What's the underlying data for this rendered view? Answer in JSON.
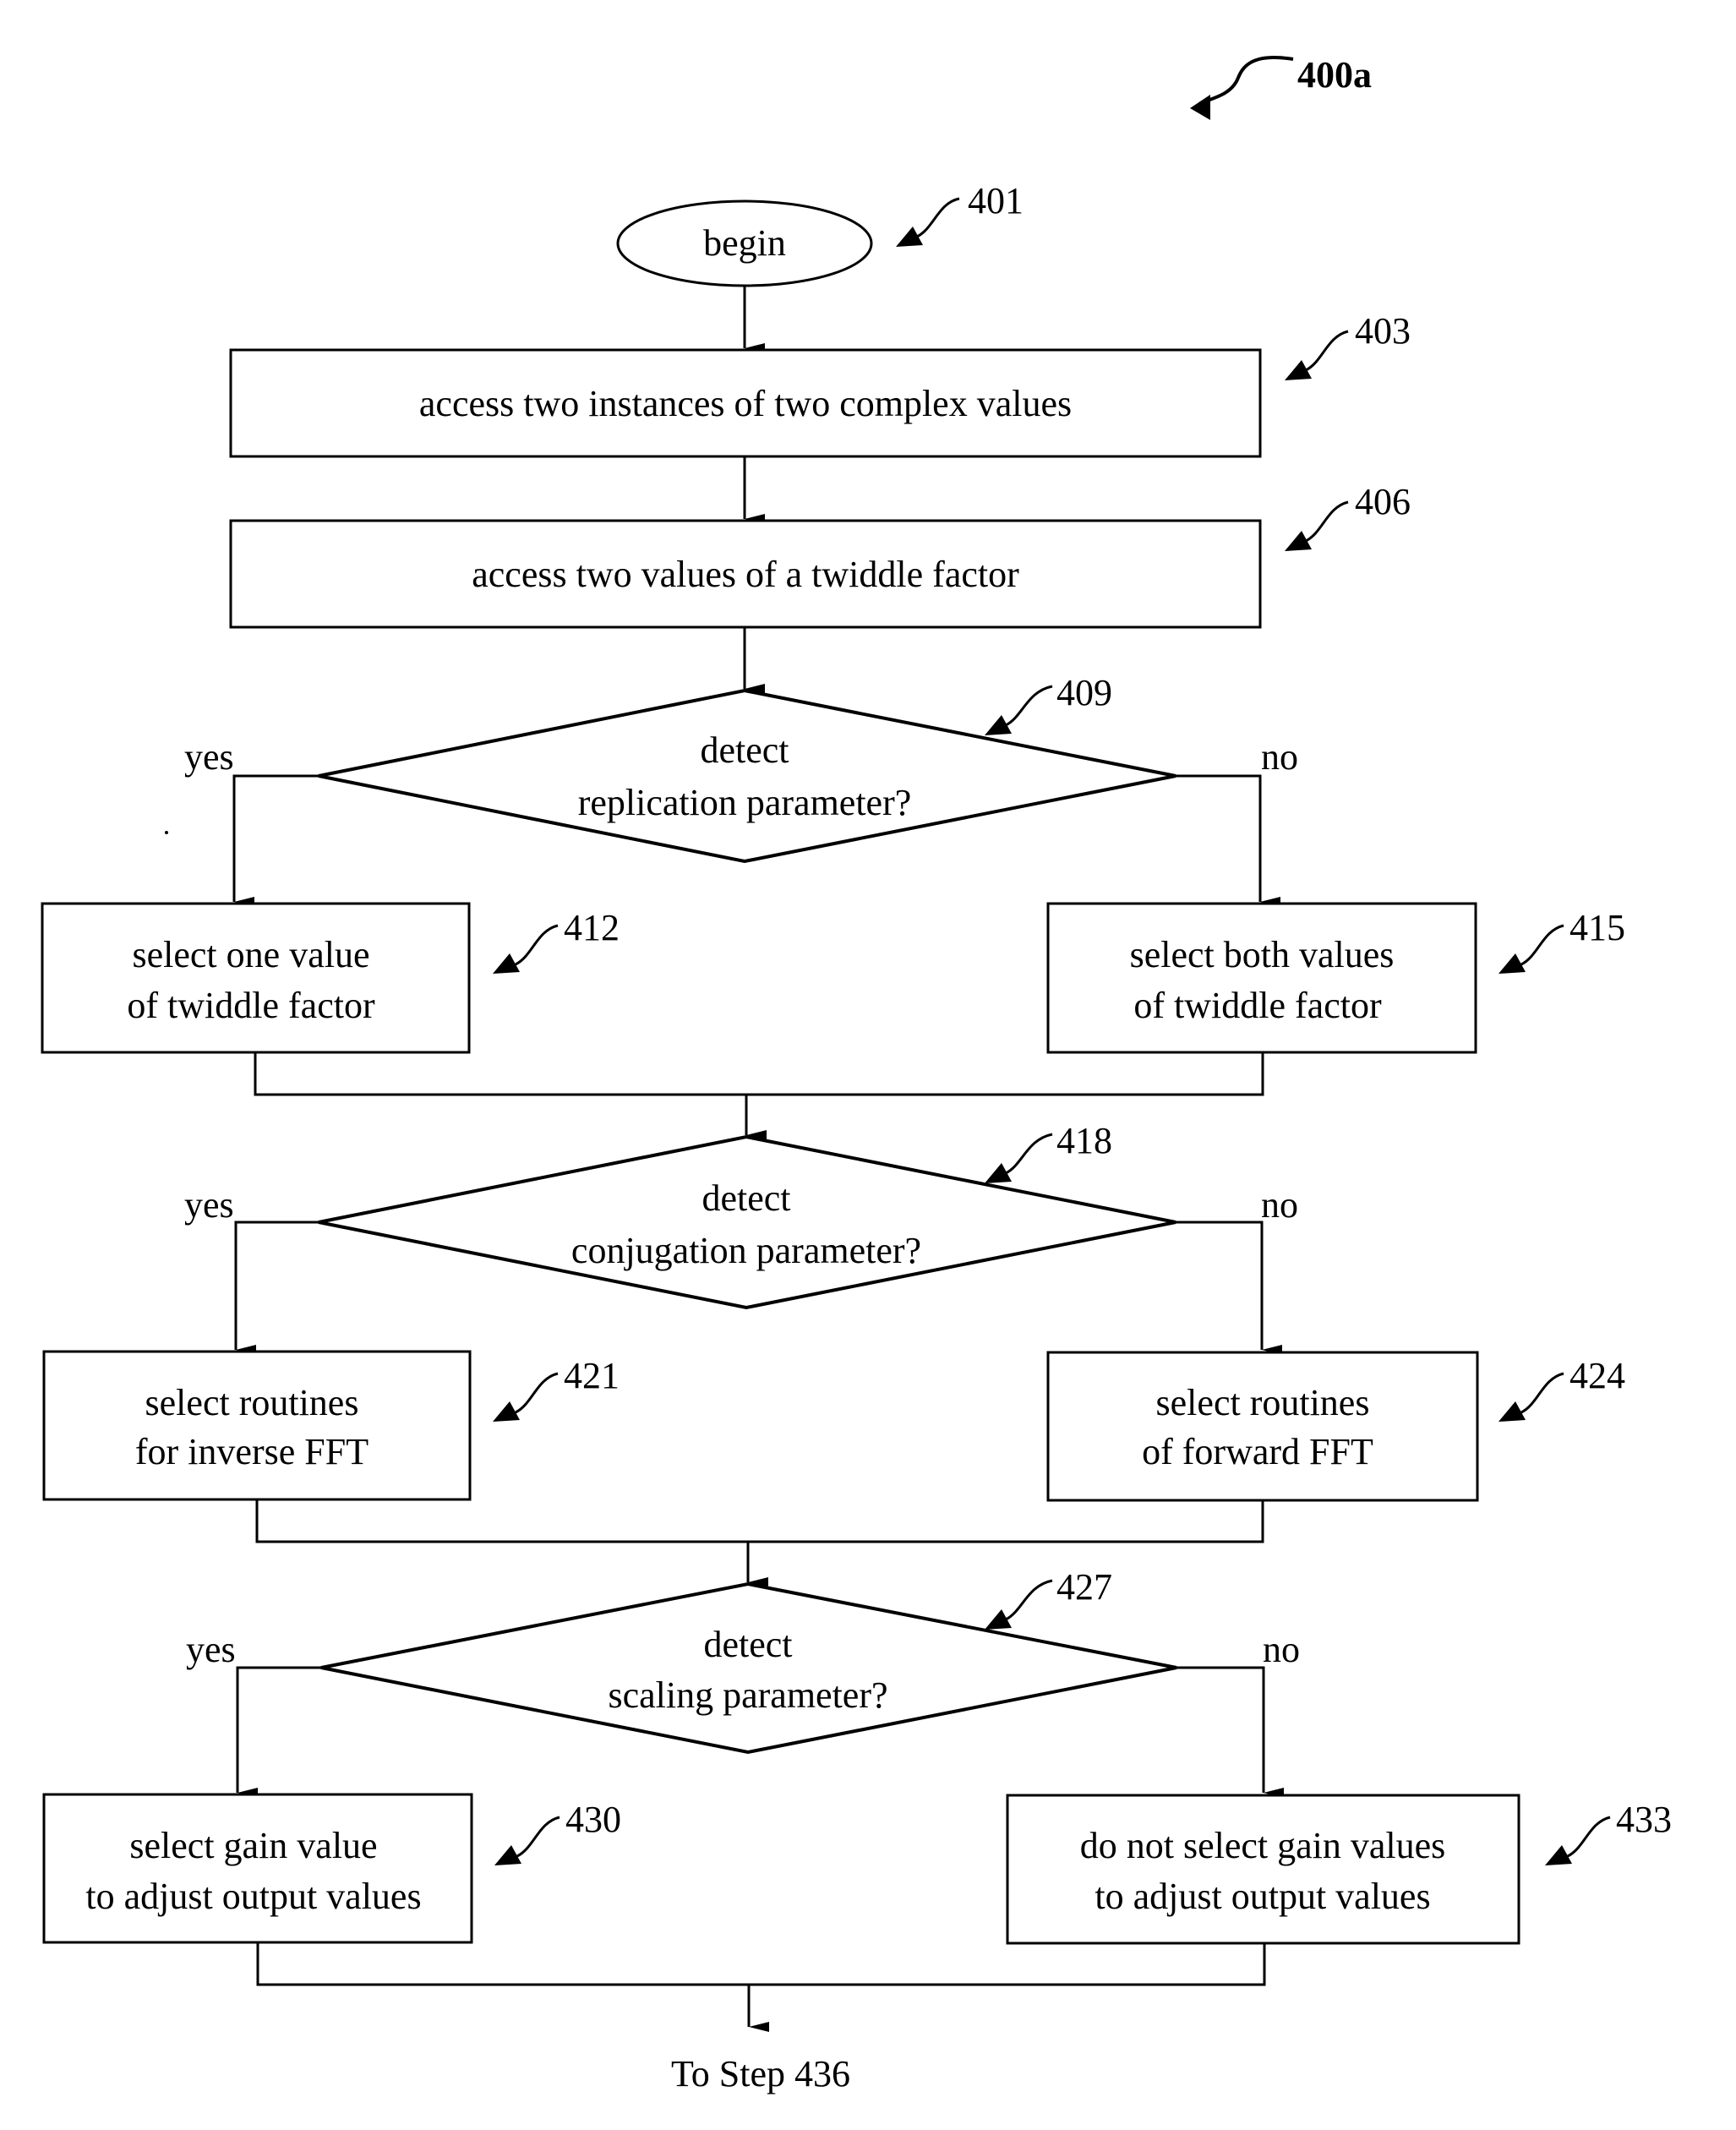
{
  "figure": {
    "label": "400a"
  },
  "nodes": {
    "begin": {
      "ref": "401",
      "text": "begin"
    },
    "n403": {
      "ref": "403",
      "text": "access two instances of two complex values"
    },
    "n406": {
      "ref": "406",
      "text": "access two values of a twiddle factor"
    },
    "n409": {
      "ref": "409",
      "line1": "detect",
      "line2": "replication parameter?"
    },
    "n412": {
      "ref": "412",
      "line1": "select one value",
      "line2": "of twiddle factor"
    },
    "n415": {
      "ref": "415",
      "line1": "select both values",
      "line2": "of twiddle factor"
    },
    "n418": {
      "ref": "418",
      "line1": "detect",
      "line2": "conjugation parameter?"
    },
    "n421": {
      "ref": "421",
      "line1": "select routines",
      "line2": "for inverse FFT"
    },
    "n424": {
      "ref": "424",
      "line1": "select routines",
      "line2": "of forward FFT"
    },
    "n427": {
      "ref": "427",
      "line1": "detect",
      "line2": "scaling parameter?"
    },
    "n430": {
      "ref": "430",
      "line1": "select gain value",
      "line2": "to adjust output values"
    },
    "n433": {
      "ref": "433",
      "line1": "do not select gain values",
      "line2": "to adjust output values"
    }
  },
  "branch_labels": {
    "yes": "yes",
    "no": "no"
  },
  "footer": {
    "text": "To Step 436"
  }
}
